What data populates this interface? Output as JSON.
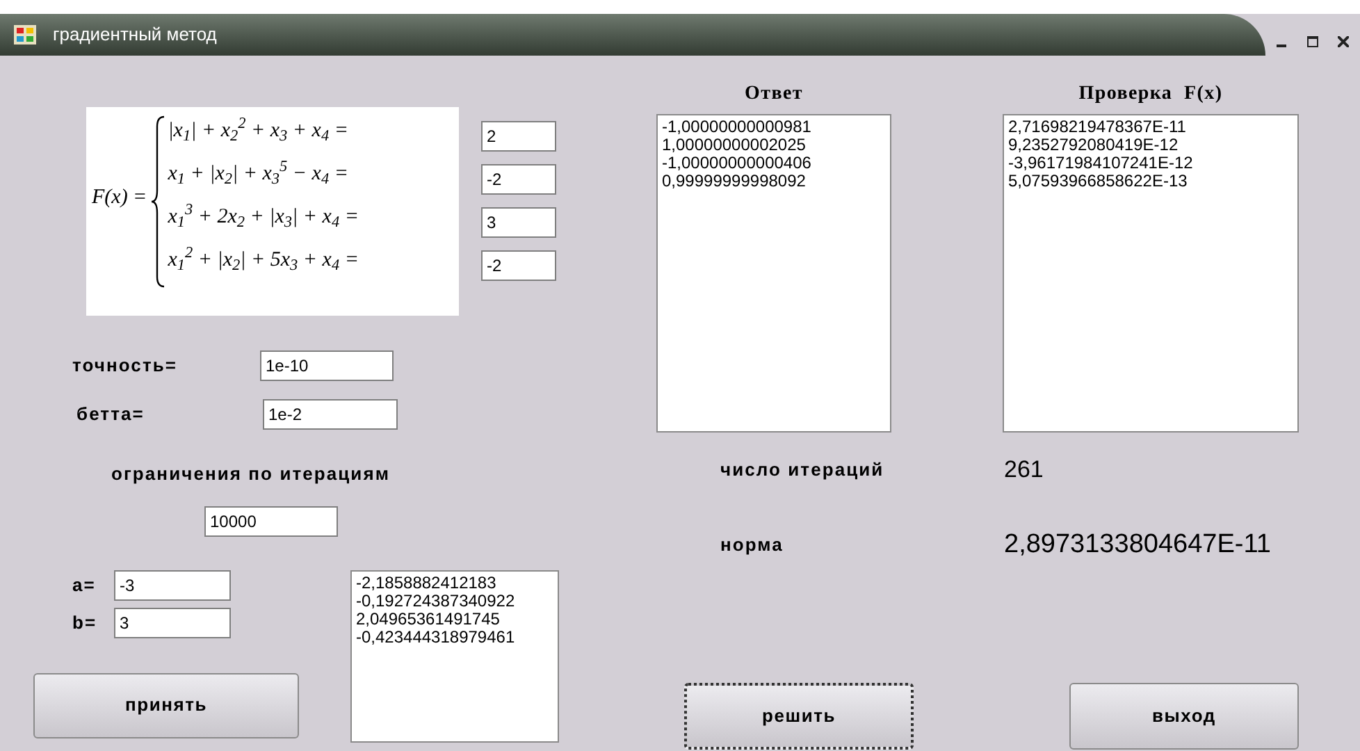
{
  "window": {
    "title": "градиентный метод"
  },
  "equation": {
    "lhs": "F(x) =",
    "rows": [
      {
        "expr": "|x$_{1}$| + x$_{2}$$^{2}$ + x$_{3}$ + x$_{4}$ =",
        "value": "2"
      },
      {
        "expr": "x$_{1}$ + |x$_{2}$| + x$_{3}$$^{5}$ − x$_{4}$ =",
        "value": "-2"
      },
      {
        "expr": "x$_{1}$$^{3}$ + 2x$_{2}$ + |x$_{3}$| + x$_{4}$ =",
        "value": "3"
      },
      {
        "expr": "x$_{1}$$^{2}$ + |x$_{2}$| + 5x$_{3}$ + x$_{4}$ =",
        "value": "-2"
      }
    ]
  },
  "accuracy": {
    "label": "точность=",
    "value": "1e-10"
  },
  "beta": {
    "label": "бетта=",
    "value": "1e-2"
  },
  "iteration_limit": {
    "label": "ограничения по итерациям",
    "value": "10000"
  },
  "a": {
    "label": "a=",
    "value": "-3"
  },
  "b": {
    "label": "b=",
    "value": "3"
  },
  "initial_list": [
    "-2,1858882412183",
    "-0,192724387340922",
    "2,04965361491745",
    "-0,423444318979461"
  ],
  "answer": {
    "heading": "Ответ",
    "lines": [
      "-1,00000000000981",
      "1,00000000002025",
      "-1,00000000000406",
      "0,99999999998092"
    ]
  },
  "check": {
    "heading": "Проверка  F(x)",
    "lines": [
      "2,71698219478367E-11",
      "9,2352792080419E-12",
      "-3,96171984107241E-12",
      "5,07593966858622E-13"
    ]
  },
  "iterations": {
    "label": "число итераций",
    "value": "261"
  },
  "norm": {
    "label": "норма",
    "value": "2,8973133804647E-11"
  },
  "buttons": [
    {
      "label": "принять",
      "focused": false
    },
    {
      "label": "решить",
      "focused": true
    },
    {
      "label": "выход",
      "focused": false
    }
  ]
}
